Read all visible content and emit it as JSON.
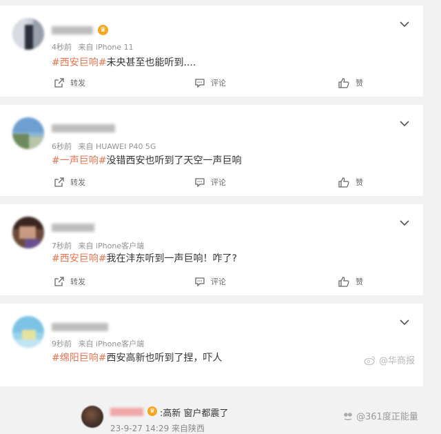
{
  "posts": [
    {
      "meta_time": "4秒前",
      "meta_source": "来自 iPhone 11",
      "has_badge": true,
      "tag": "#西安巨响#",
      "text": "未央甚至也能听到....",
      "actions": {
        "share": "转发",
        "comment": "评论",
        "like": "赞"
      }
    },
    {
      "meta_time": "6秒前",
      "meta_source": "来自 HUAWEI P40 5G",
      "has_badge": false,
      "tag": "#一声巨响#",
      "text": "没错西安也听到了天空一声巨响",
      "actions": {
        "share": "转发",
        "comment": "评论",
        "like": "赞"
      }
    },
    {
      "meta_time": "7秒前",
      "meta_source": "来自 iPhone客户端",
      "has_badge": false,
      "tag": "#西安巨响#",
      "text": "我在沣东听到一声巨响！咋了?",
      "actions": {
        "share": "转发",
        "comment": "评论",
        "like": "赞"
      }
    },
    {
      "meta_time": "9秒前",
      "meta_source": "来自 iPhone客户端",
      "has_badge": false,
      "tag": "#绵阳巨响#",
      "text": "西安高新也听到了捏，吓人",
      "actions": {
        "share": "转发",
        "comment": "评论",
        "like": "赞"
      }
    }
  ],
  "reply": {
    "text": ":高新  窗户都震了",
    "meta": "23-9-27 14:29 来自陕西"
  },
  "watermarks": {
    "weibo": "@华商报",
    "toutiao": "@361度正能量"
  },
  "colors": {
    "tag": "#eb7350",
    "badge": "#f5a623",
    "meta": "#939393"
  }
}
